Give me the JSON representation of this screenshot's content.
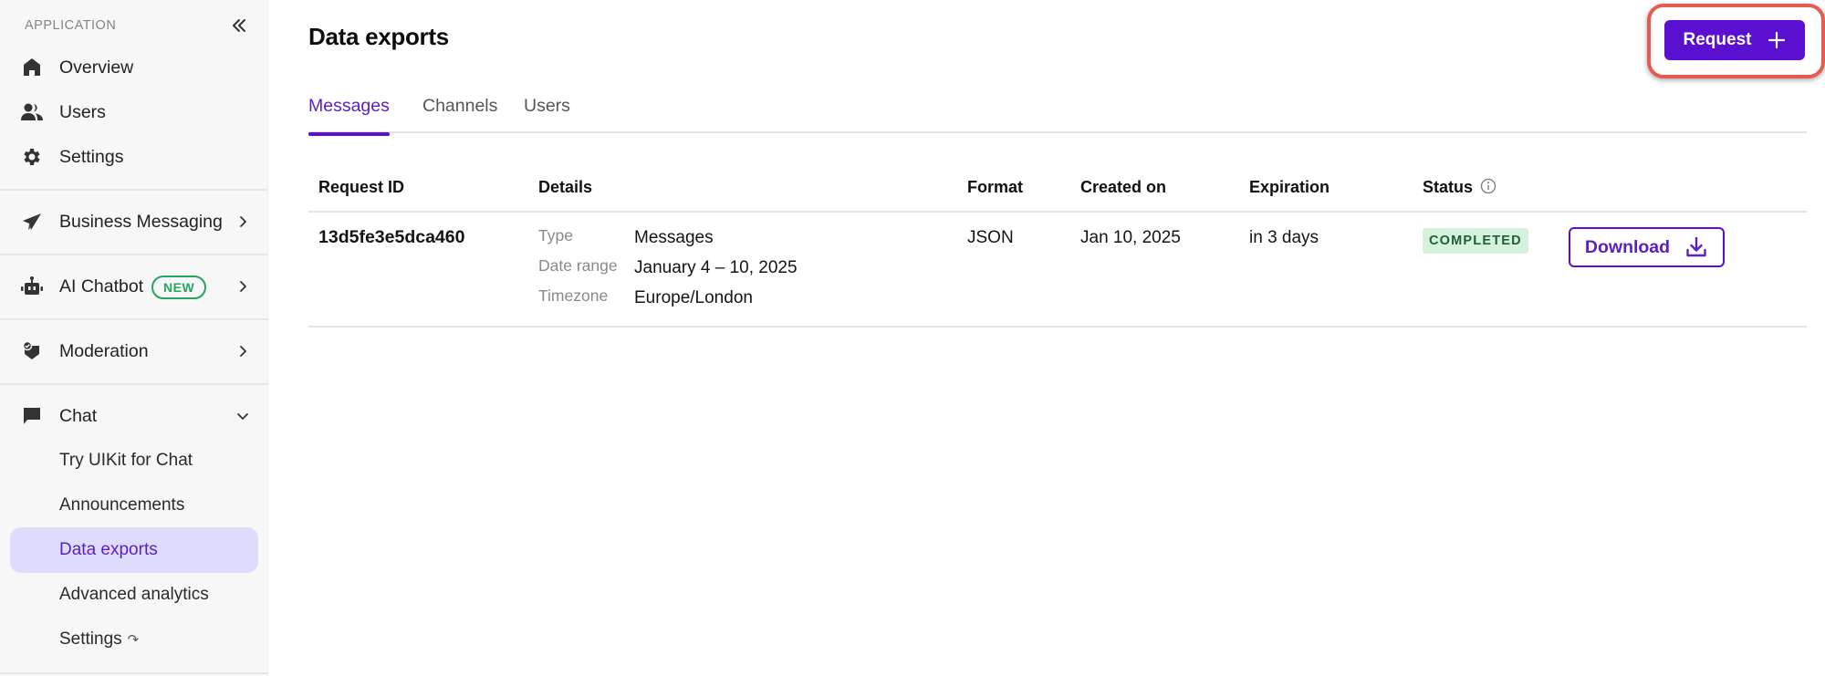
{
  "sidebar": {
    "section_label": "APPLICATION",
    "items": [
      {
        "label": "Overview",
        "icon": "home-icon"
      },
      {
        "label": "Users",
        "icon": "users-icon"
      },
      {
        "label": "Settings",
        "icon": "gear-icon"
      },
      {
        "label": "Business Messaging",
        "icon": "paper-plane-icon",
        "expandable": true
      },
      {
        "label": "AI Chatbot",
        "icon": "robot-icon",
        "badge": "NEW",
        "expandable": true
      },
      {
        "label": "Moderation",
        "icon": "shield-check-icon",
        "expandable": true
      },
      {
        "label": "Chat",
        "icon": "chat-bubble-icon",
        "expanded": true
      }
    ],
    "chat_subitems": [
      {
        "label": "Try UIKit for Chat"
      },
      {
        "label": "Announcements"
      },
      {
        "label": "Data exports",
        "active": true
      },
      {
        "label": "Advanced analytics"
      },
      {
        "label": "Settings",
        "external": true
      }
    ]
  },
  "header": {
    "title": "Data exports",
    "request_button": "Request"
  },
  "tabs": [
    {
      "label": "Messages",
      "active": true
    },
    {
      "label": "Channels"
    },
    {
      "label": "Users"
    }
  ],
  "table": {
    "columns": [
      "Request ID",
      "Details",
      "Format",
      "Created on",
      "Expiration",
      "Status"
    ],
    "rows": [
      {
        "request_id": "13d5fe3e5dca460",
        "details": [
          {
            "key": "Type",
            "value": "Messages"
          },
          {
            "key": "Date range",
            "value": "January 4 – 10, 2025"
          },
          {
            "key": "Timezone",
            "value": "Europe/London"
          }
        ],
        "format": "JSON",
        "created_on": "Jan 10, 2025",
        "expiration": "in 3 days",
        "status": "COMPLETED",
        "action": "Download"
      }
    ]
  },
  "colors": {
    "accent": "#5b0fd1",
    "active_bg": "#dedcfc",
    "status_bg": "#d5f2dd",
    "status_text": "#1f5f35",
    "new_badge": "#25a65d",
    "highlight": "#e85a4f"
  }
}
